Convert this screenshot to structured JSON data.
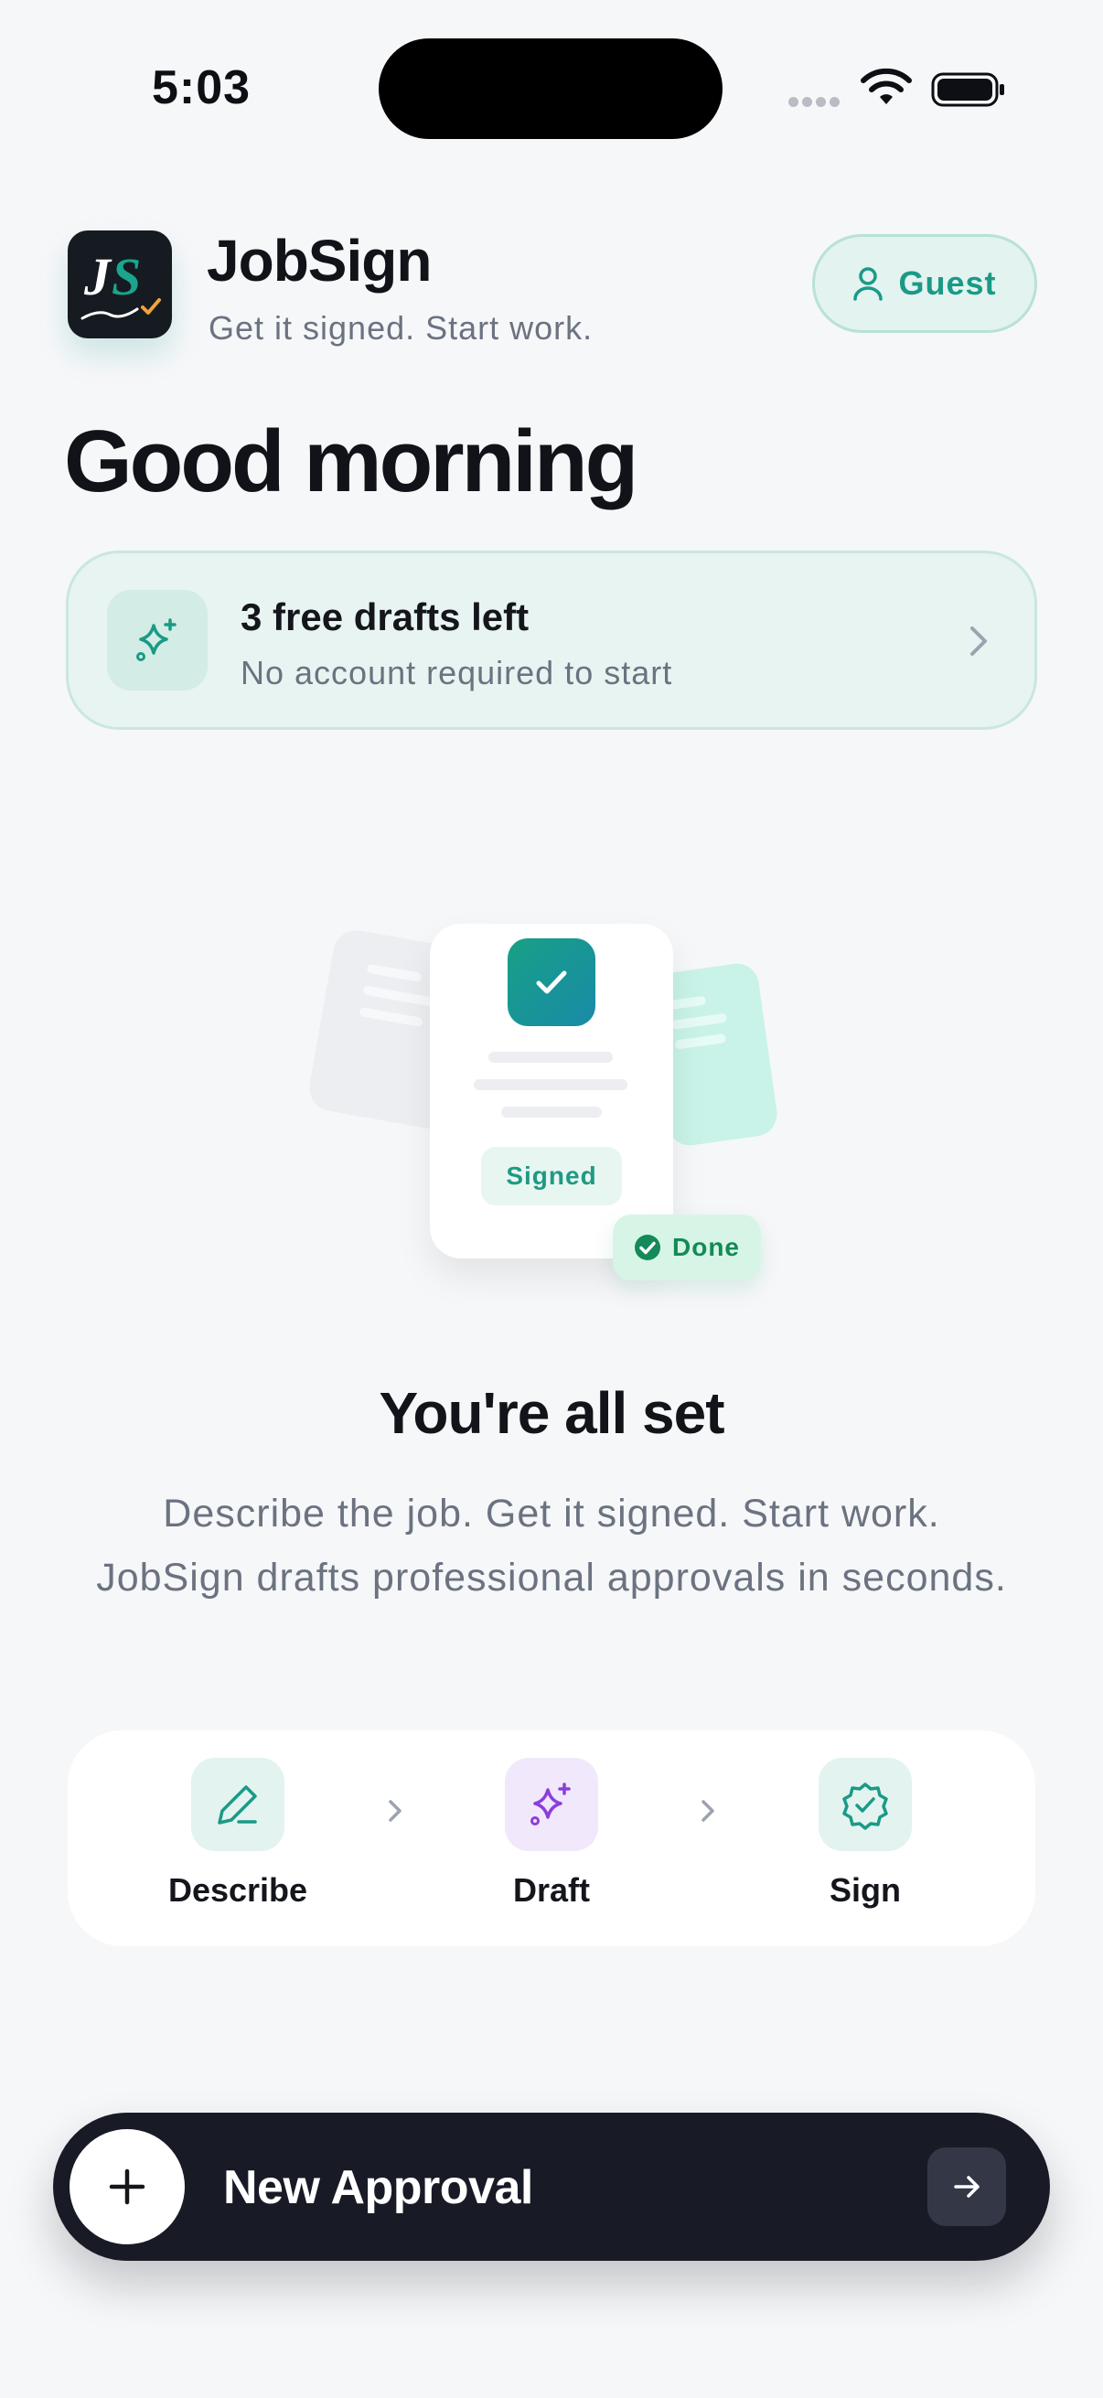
{
  "status_bar": {
    "time": "5:03",
    "icons": [
      "signal-dots-icon",
      "wifi-icon",
      "battery-icon"
    ]
  },
  "header": {
    "logo_text": "JS",
    "app_name": "JobSign",
    "tagline": "Get it signed. Start work.",
    "guest_label": "Guest"
  },
  "greeting": "Good morning",
  "drafts_card": {
    "title": "3 free drafts left",
    "subtitle": "No account required to start"
  },
  "illustration": {
    "signed_label": "Signed",
    "done_label": "Done"
  },
  "empty_state": {
    "title": "You're all set",
    "description": "Describe the job. Get it signed. Start work. JobSign drafts professional approvals in seconds."
  },
  "steps": [
    {
      "label": "Describe",
      "icon": "pencil-icon"
    },
    {
      "label": "Draft",
      "icon": "sparkle-icon"
    },
    {
      "label": "Sign",
      "icon": "badge-check-icon"
    }
  ],
  "cta": {
    "label": "New Approval"
  },
  "colors": {
    "accent": "#1a9a86",
    "purple": "#8b3fd9",
    "dark": "#181b26",
    "background": "#f6f7f9"
  }
}
